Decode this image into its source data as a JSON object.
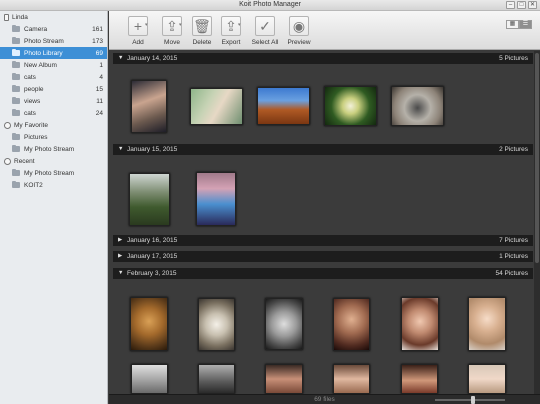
{
  "window": {
    "title": "Koit Photo Manager",
    "min_glyph": "–",
    "max_glyph": "□",
    "close_glyph": "✕"
  },
  "sidebar": {
    "device": "Linda",
    "items": [
      {
        "label": "Camera",
        "count": "161"
      },
      {
        "label": "Photo Stream",
        "count": "173"
      },
      {
        "label": "Photo Library",
        "count": "69",
        "selected": true
      },
      {
        "label": "New Album",
        "count": "1"
      },
      {
        "label": "cats",
        "count": "4"
      },
      {
        "label": "people",
        "count": "15"
      },
      {
        "label": "views",
        "count": "11"
      },
      {
        "label": "cats",
        "count": "24"
      }
    ],
    "favorite": {
      "title": "My Favorite",
      "items": [
        "Pictures",
        "My Photo Stream"
      ]
    },
    "recent": {
      "title": "Recent",
      "items": [
        "My Photo Stream",
        "KOIT2"
      ]
    }
  },
  "toolbar": {
    "add": "Add",
    "move": "Move",
    "delete": "Delete",
    "export": "Export",
    "select_all": "Select All",
    "preview": "Preview",
    "icons": {
      "add": "+",
      "move": "⇪",
      "delete": "🗑",
      "export": "⇪",
      "select_all": "✓",
      "preview": "◉"
    }
  },
  "groups": [
    {
      "date": "January 14, 2015",
      "count": "5 Pictures",
      "expanded": true
    },
    {
      "date": "January 15, 2015",
      "count": "2 Pictures",
      "expanded": true
    },
    {
      "date": "January 16, 2015",
      "count": "7 Pictures",
      "expanded": false
    },
    {
      "date": "January 17, 2015",
      "count": "1 Pictures",
      "expanded": false
    },
    {
      "date": "February 3, 2015",
      "count": "54 Pictures",
      "expanded": true
    }
  ],
  "status": {
    "files": "69 files"
  },
  "colors": {
    "accent": "#3d8fd6",
    "content_bg": "#3b3b3b",
    "group_bar": "#1d1d1d"
  }
}
